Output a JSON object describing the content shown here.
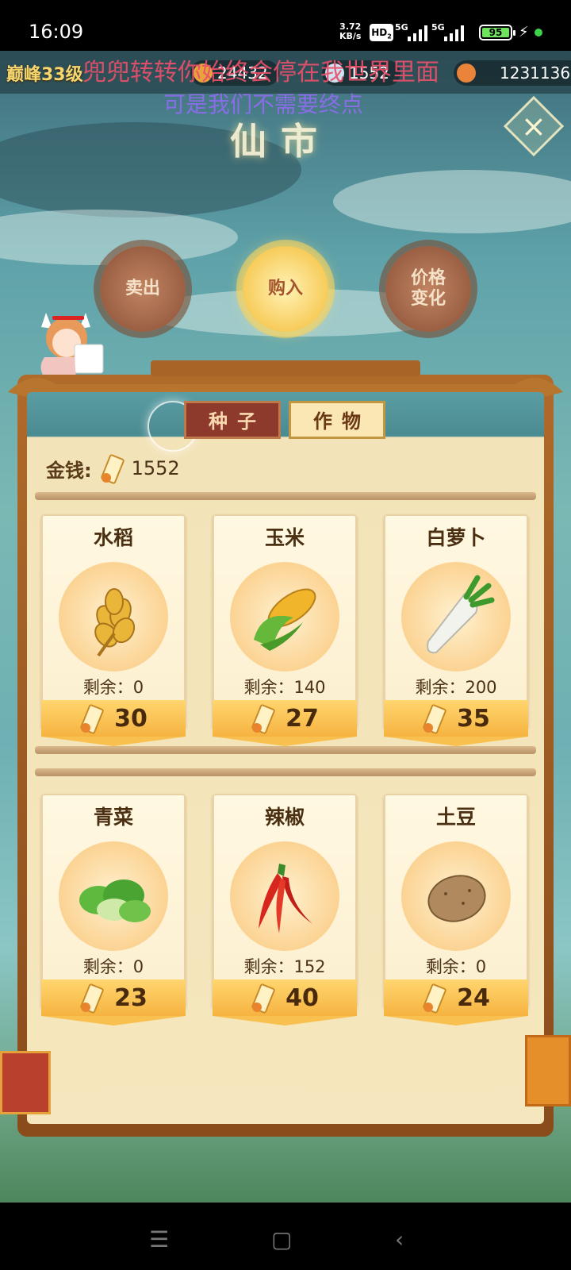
{
  "status_bar": {
    "time": "16:09",
    "net_speed_value": "3.72",
    "net_speed_unit": "KB/s",
    "hd_label": "HD",
    "hd_sub": "2",
    "sim1_label": "5G",
    "sim2_label": "5G",
    "battery": "95"
  },
  "top_bar": {
    "level": "巅峰33级",
    "resource_1": "24432",
    "resource_2": "1552",
    "resource_3": "1231136"
  },
  "overlay": {
    "line1": "兜兜转转你始终会停在我世界里面",
    "line2": "可是我们不需要终点"
  },
  "page": {
    "title": "仙市"
  },
  "actions": {
    "sell": "卖出",
    "buy": "购入",
    "price_change": "价格\n变化"
  },
  "tabs": {
    "seed": "种子",
    "crop": "作物"
  },
  "money": {
    "label": "金钱:",
    "value": "1552"
  },
  "items": [
    {
      "name": "水稻",
      "remain": "剩余：0",
      "price": "30"
    },
    {
      "name": "玉米",
      "remain": "剩余：140",
      "price": "27"
    },
    {
      "name": "白萝卜",
      "remain": "剩余：200",
      "price": "35"
    },
    {
      "name": "青菜",
      "remain": "剩余：0",
      "price": "23"
    },
    {
      "name": "辣椒",
      "remain": "剩余：152",
      "price": "40"
    },
    {
      "name": "土豆",
      "remain": "剩余：0",
      "price": "24"
    }
  ],
  "colors": {
    "accent_gold": "#f6b340",
    "panel_wood": "#8a4c1b",
    "tab_active": "#8d3a2c"
  }
}
